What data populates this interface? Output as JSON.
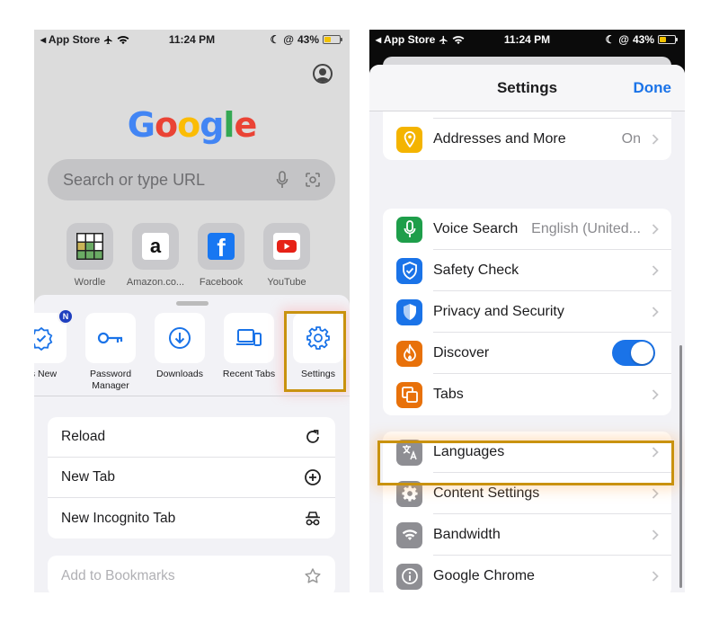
{
  "left": {
    "status": {
      "carrier": "◂ App Store",
      "time": "11:24 PM",
      "battery": "43%",
      "battery_level": 0.43
    },
    "logo": {
      "letters": [
        "G",
        "o",
        "o",
        "g",
        "l",
        "e"
      ],
      "colors": [
        "#4285F4",
        "#EA4335",
        "#FBBC05",
        "#4285F4",
        "#34A853",
        "#EA4335"
      ]
    },
    "search": {
      "placeholder": "Search or type URL"
    },
    "shortcuts": [
      {
        "label": "Wordle",
        "icon": "wordle-icon"
      },
      {
        "label": "Amazon.co...",
        "icon": "amazon-icon",
        "glyph": "a"
      },
      {
        "label": "Facebook",
        "icon": "facebook-icon",
        "glyph": "f"
      },
      {
        "label": "YouTube",
        "icon": "youtube-icon"
      }
    ],
    "actions": [
      {
        "label": "t's New",
        "icon": "whats-new-icon",
        "badge": "N"
      },
      {
        "label": "Password Manager",
        "icon": "key-icon"
      },
      {
        "label": "Downloads",
        "icon": "download-icon"
      },
      {
        "label": "Recent Tabs",
        "icon": "devices-icon"
      },
      {
        "label": "Settings",
        "icon": "gear-icon"
      }
    ],
    "menu": [
      {
        "label": "Reload",
        "icon": "reload-icon"
      },
      {
        "label": "New Tab",
        "icon": "plus-circle-icon"
      },
      {
        "label": "New Incognito Tab",
        "icon": "incognito-icon"
      }
    ],
    "menu2": [
      {
        "label": "Add to Bookmarks",
        "icon": "star-icon"
      }
    ],
    "highlight_color": "#C9920F"
  },
  "right": {
    "status": {
      "carrier": "◂ App Store",
      "time": "11:24 PM",
      "battery": "43%",
      "battery_level": 0.43
    },
    "nav": {
      "title": "Settings",
      "done": "Done"
    },
    "group1": [
      {
        "label": "Addresses and More",
        "value": "On",
        "icon": "location-pin-icon",
        "color": "#F4B400"
      }
    ],
    "group2": [
      {
        "label": "Voice Search",
        "value": "English (United...",
        "icon": "mic-icon",
        "color": "#1E9E4A"
      },
      {
        "label": "Safety Check",
        "value": "",
        "icon": "shield-check-icon",
        "color": "#1A73E8"
      },
      {
        "label": "Privacy and Security",
        "value": "",
        "icon": "shield-icon",
        "color": "#1A73E8"
      },
      {
        "label": "Discover",
        "value": "",
        "icon": "flame-icon",
        "color": "#E8710A",
        "toggle": true
      },
      {
        "label": "Tabs",
        "value": "",
        "icon": "tabs-icon",
        "color": "#E8710A"
      }
    ],
    "group3": [
      {
        "label": "Languages",
        "value": "",
        "icon": "translate-icon",
        "color": "#8E8E93"
      },
      {
        "label": "Content Settings",
        "value": "",
        "icon": "gear-icon",
        "color": "#8E8E93"
      },
      {
        "label": "Bandwidth",
        "value": "",
        "icon": "wifi-icon",
        "color": "#8E8E93"
      },
      {
        "label": "Google Chrome",
        "value": "",
        "icon": "info-icon",
        "color": "#8E8E93"
      }
    ],
    "accent": "#1A73E8"
  }
}
